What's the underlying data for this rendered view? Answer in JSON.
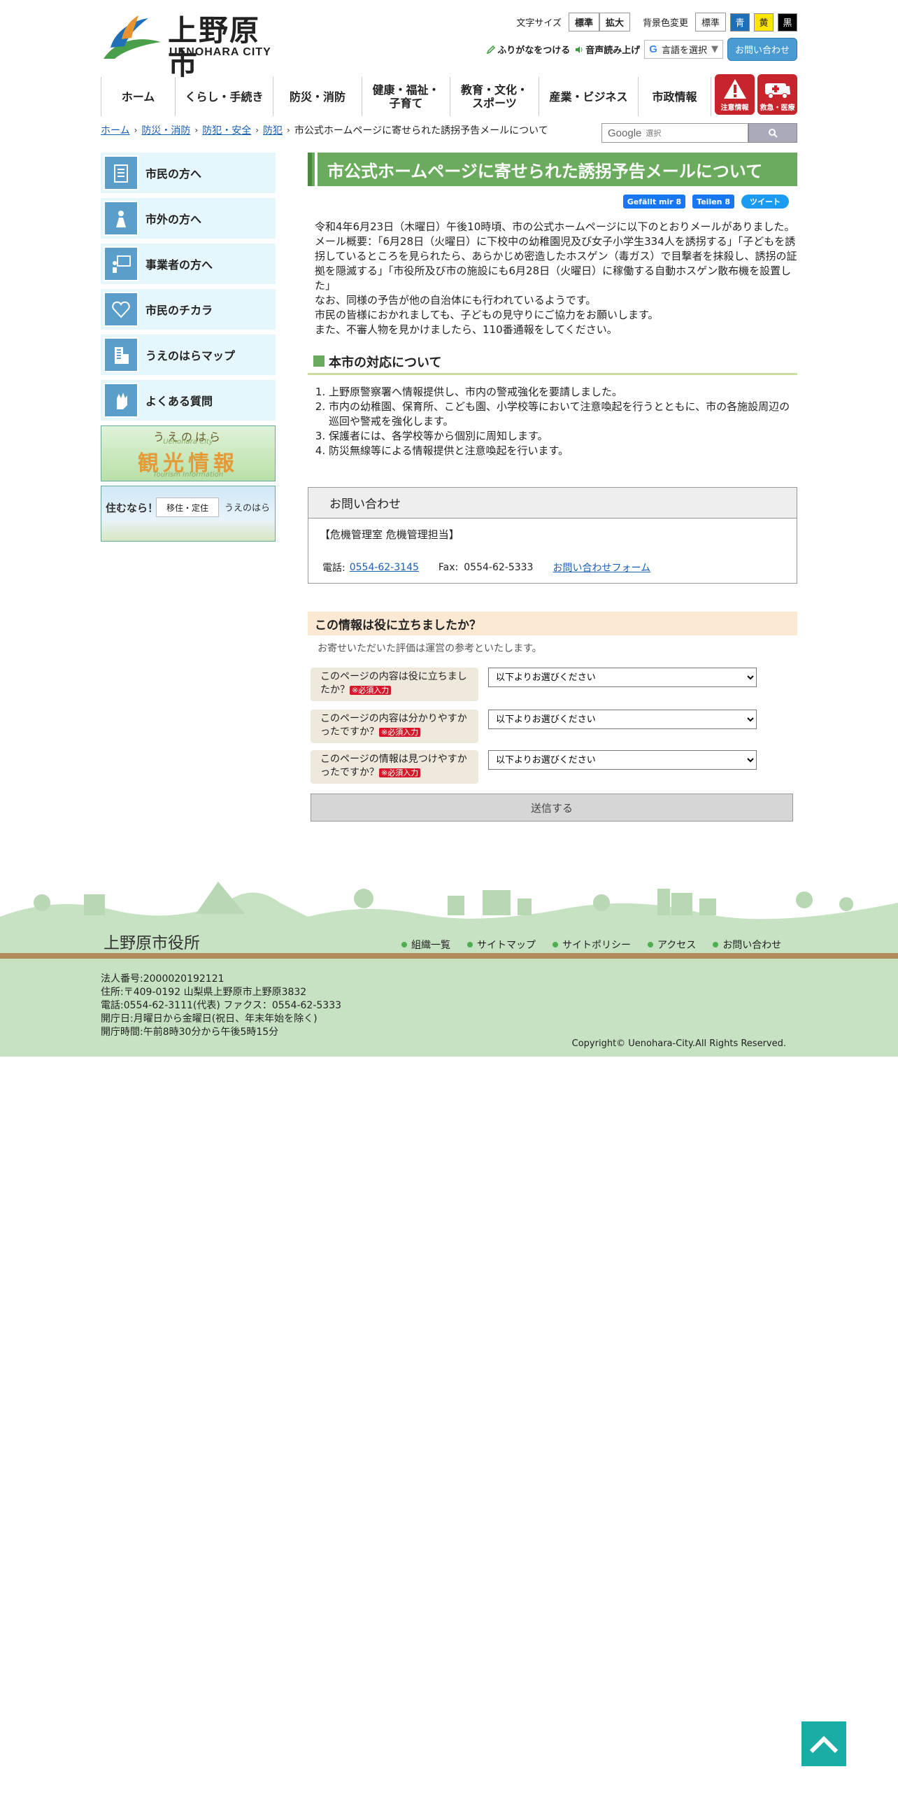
{
  "header": {
    "logo_jp": "上野原市",
    "logo_en": "UENOHARA CITY",
    "text_size_label": "文字サイズ",
    "text_size_standard": "標準",
    "text_size_large": "拡大",
    "bg_color_label": "背景色変更",
    "bg_standard": "標準",
    "bg_blue": "青",
    "bg_yellow": "黄",
    "bg_black": "黒",
    "furigana": "ふりがなをつける",
    "speech": "音声読み上げ",
    "translate": "言語を選択",
    "contact": "お問い合わせ"
  },
  "nav": [
    "ホーム",
    "くらし・手続き",
    "防災・消防",
    "健康・福祉・\n子育て",
    "教育・文化・\nスポーツ",
    "産業・ビジネス",
    "市政情報"
  ],
  "alerts": {
    "warning": "注意情報",
    "emergency": "救急・医療"
  },
  "breadcrumb": [
    "ホーム",
    "防災・消防",
    "防犯・安全",
    "防犯",
    "市公式ホームページに寄せられた誘拐予告メールについて"
  ],
  "search": {
    "placeholder": "選択",
    "brand": "Google"
  },
  "sidebar": [
    "市民の方へ",
    "市外の方へ",
    "事業者の方へ",
    "市民のチカラ",
    "うえのはらマップ",
    "よくある質問"
  ],
  "banner_tourism": {
    "top": "うえのはら",
    "sub": "Uenohara City",
    "main": "観光情報",
    "foot": "Tourism Information"
  },
  "banner_live": {
    "left": "住むなら！",
    "box": "移住・定住",
    "right": "うえのはら"
  },
  "page": {
    "title": "市公式ホームページに寄せられた誘拐予告メールについて",
    "social_like": "Gefällt mir 8",
    "social_share": "Teilen 8",
    "social_tweet": "ツイート",
    "body": [
      "令和4年6月23日（木曜日）午後10時頃、市の公式ホームページに以下のとおりメールがありました。",
      "メール概要：「6月28日（火曜日）に下校中の幼稚園児及び女子小学生334人を誘拐する」「子どもを誘拐しているところを見られたら、あらかじめ密造したホスゲン（毒ガス）で目撃者を抹殺し、誘拐の証拠を隠滅する」「市役所及び市の施設にも6月28日（火曜日）に稼働する自動ホスゲン散布機を設置した」",
      "なお、同様の予告が他の自治体にも行われているようです。",
      "市民の皆様におかれましても、子どもの見守りにご協力をお願いします。",
      "また、不審人物を見かけましたら、110番通報をしてください。"
    ],
    "section_heading": "本市の対応について",
    "measures": [
      "上野原警察署へ情報提供し、市内の警戒強化を要請しました。",
      "市内の幼稚園、保育所、こども園、小学校等において注意喚起を行うとともに、市の各施設周辺の巡回や警戒を強化します。",
      "保護者には、各学校等から個別に周知します。",
      "防災無線等による情報提供と注意喚起を行います。"
    ]
  },
  "inquiry": {
    "heading": "お問い合わせ",
    "dept": "【危機管理室 危機管理担当】",
    "tel_label": "電話:",
    "tel": "0554-62-3145",
    "fax_label": "Fax:",
    "fax": "0554-62-5333",
    "form_link": "お問い合わせフォーム"
  },
  "survey": {
    "heading": "この情報は役に立ちましたか？",
    "note": "お寄せいただいた評価は運営の参考といたします。",
    "required": "※必須入力",
    "select_default": "以下よりお選びください",
    "questions": [
      "このページの内容は役に立ちましたか？",
      "このページの内容は分かりやすかったですか？",
      "このページの情報は見つけやすかったですか？"
    ],
    "submit": "送信する"
  },
  "footer": {
    "title": "上野原市役所",
    "links": [
      "組織一覧",
      "サイトマップ",
      "サイトポリシー",
      "アクセス",
      "お問い合わせ"
    ],
    "info": [
      "法人番号:2000020192121",
      "住所:〒409-0192 山梨県上野原市上野原3832",
      "電話:0554-62-3111(代表) ファクス：0554-62-5333",
      "開庁日:月曜日から金曜日(祝日、年末年始を除く)",
      "開庁時間:午前8時30分から午後5時15分"
    ],
    "copyright": "Copyright© Uenohara-City.All Rights Reserved."
  },
  "colors": {
    "title_green": "#6aab5e",
    "alert_red": "#c8242c",
    "footer_green": "#c7e2c3",
    "pagetop_teal": "#1aada5"
  }
}
